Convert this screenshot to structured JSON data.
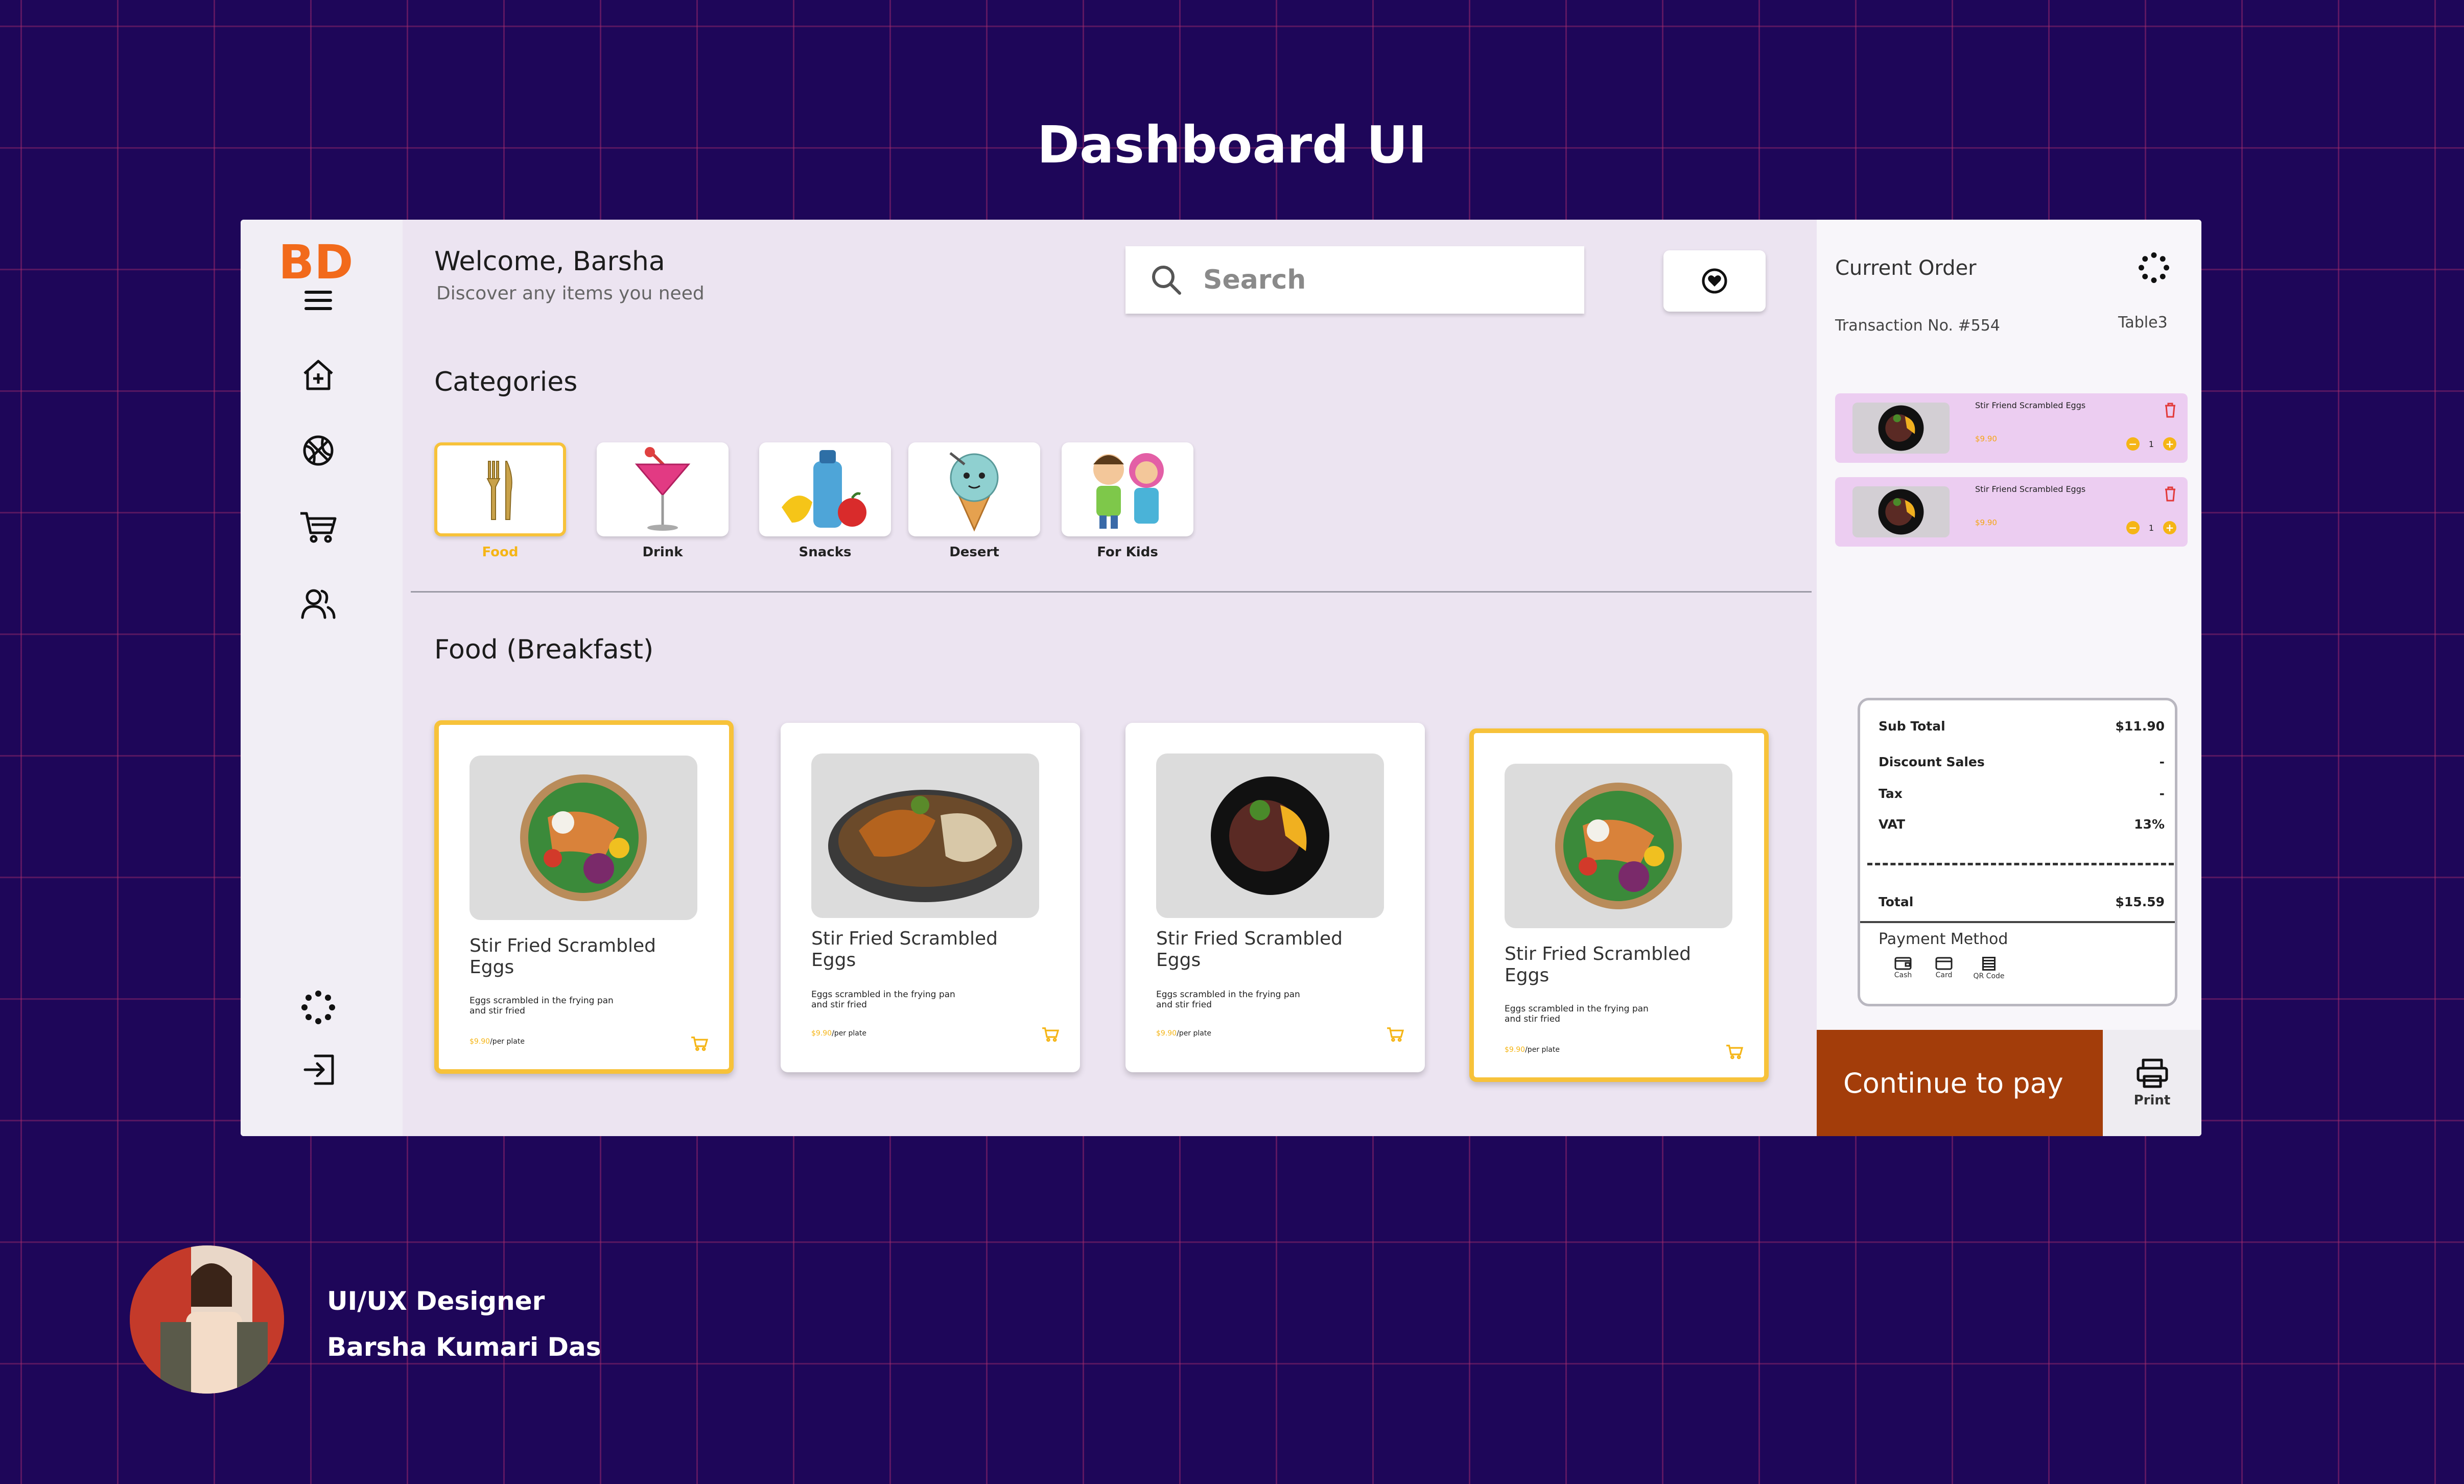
{
  "page": {
    "title": "Dashboard UI"
  },
  "sidebar": {
    "logo": "BD",
    "nav": [
      "menu-icon",
      "home-icon",
      "basketball-icon",
      "cart-icon",
      "users-icon",
      "settings-icon",
      "logout-icon"
    ]
  },
  "header": {
    "welcome": "Welcome, Barsha",
    "subtitle": "Discover any items you need",
    "search_placeholder": "Search",
    "favorite_icon": "heart-icon"
  },
  "categories": {
    "title": "Categories",
    "items": [
      {
        "label": "Food",
        "icon": "fork-knife-icon",
        "selected": true
      },
      {
        "label": "Drink",
        "icon": "cocktail-icon",
        "selected": false
      },
      {
        "label": "Snacks",
        "icon": "snacks-icon",
        "selected": false
      },
      {
        "label": "Desert",
        "icon": "ice-cream-icon",
        "selected": false
      },
      {
        "label": "For Kids",
        "icon": "kids-icon",
        "selected": false
      }
    ]
  },
  "food": {
    "title": "Food (Breakfast)",
    "items": [
      {
        "name": "Stir Fried Scrambled Eggs",
        "desc": "Eggs scrambled in the frying pan and stir fried",
        "price": "$9.90",
        "unit": "/per plate",
        "selected": true
      },
      {
        "name": "Stir Fried Scrambled Eggs",
        "desc": "Eggs scrambled in the frying pan and stir fried",
        "price": "$9.90",
        "unit": "/per plate",
        "selected": false
      },
      {
        "name": "Stir Fried Scrambled Eggs",
        "desc": "Eggs scrambled in the frying pan and stir fried",
        "price": "$9.90",
        "unit": "/per plate",
        "selected": false
      },
      {
        "name": "Stir Fried Scrambled Eggs",
        "desc": "Eggs scrambled in the frying pan and stir fried",
        "price": "$9.90",
        "unit": "/per plate",
        "selected": true
      }
    ]
  },
  "order": {
    "title": "Current Order",
    "transaction": "Transaction No. #554",
    "table": "Table3",
    "items": [
      {
        "name": "Stir Friend Scrambled Eggs",
        "price": "$9.90",
        "qty": "1"
      },
      {
        "name": "Stir Friend Scrambled Eggs",
        "price": "$9.90",
        "qty": "1"
      }
    ],
    "summary": {
      "subtotal_label": "Sub Total",
      "subtotal": "$11.90",
      "discount_label": "Discount Sales",
      "discount": "-",
      "tax_label": "Tax",
      "tax": "-",
      "vat_label": "VAT",
      "vat": "13%",
      "total_label": "Total",
      "total": "$15.59"
    },
    "payment": {
      "title": "Payment Method",
      "methods": [
        "Cash",
        "Card",
        "QR Code"
      ]
    },
    "pay_button": "Continue to pay",
    "print_button": "Print"
  },
  "designer": {
    "role": "UI/UX Designer",
    "name": "Barsha Kumari Das"
  },
  "colors": {
    "background": "#1e0659",
    "accent": "#f7c23a",
    "brand": "#f26a1b",
    "pay": "#a33d0a",
    "order_item_bg": "#eccdf1"
  }
}
